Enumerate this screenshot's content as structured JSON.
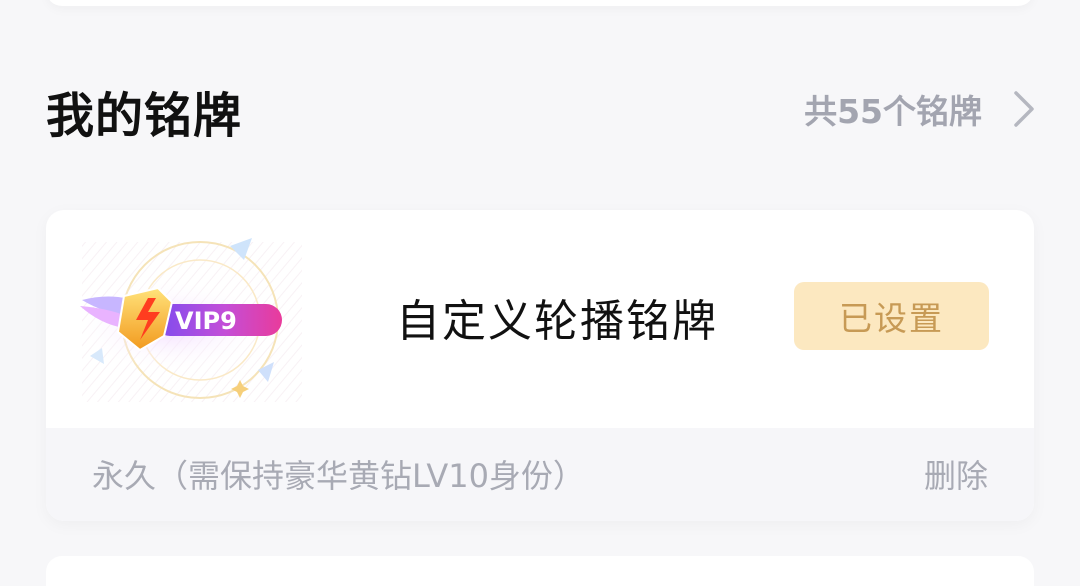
{
  "section": {
    "title": "我的铭牌",
    "count_text": "共55个铭牌",
    "chevron_icon": "chevron-right-icon"
  },
  "medal": {
    "badge_text": "VIP9",
    "badge_icon": "vip-lightning-badge-icon",
    "name": "自定义轮播铭牌",
    "set_button_label": "已设置",
    "validity": "永久（需保持豪华黄钻LV10身份）",
    "delete_label": "删除"
  },
  "colors": {
    "button_bg": "#fce8c0",
    "button_text": "#c79a55",
    "muted_text": "#a8aab4",
    "badge_pink": "#e93b9b",
    "badge_purple": "#7b4cf0",
    "badge_gold": "#ffcc33"
  }
}
